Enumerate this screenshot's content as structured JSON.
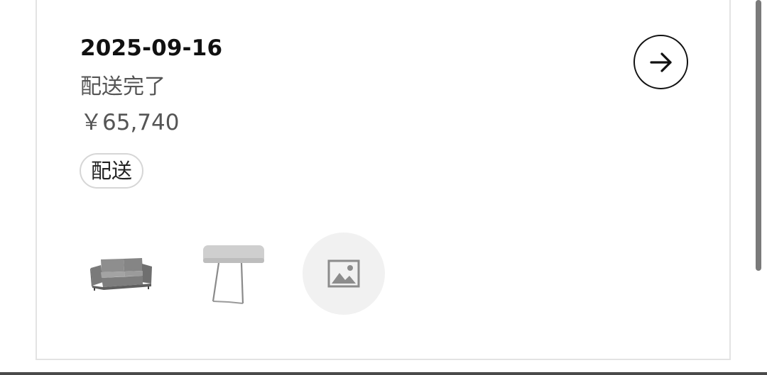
{
  "order": {
    "date": "2025-09-16",
    "status": "配送完了",
    "price": "￥65,740",
    "tag": "配送"
  },
  "icons": {
    "detail_button": "arrow-right-icon",
    "placeholder": "image-placeholder-icon"
  },
  "thumbnails": [
    {
      "name": "sofa-thumbnail",
      "kind": "product-image"
    },
    {
      "name": "headrest-thumbnail",
      "kind": "product-image"
    },
    {
      "name": "image-placeholder",
      "kind": "placeholder"
    }
  ],
  "colors": {
    "text_primary": "#111111",
    "text_secondary": "#555555",
    "card_border": "#e3e3e3",
    "placeholder_bg": "#f1f1f1"
  }
}
